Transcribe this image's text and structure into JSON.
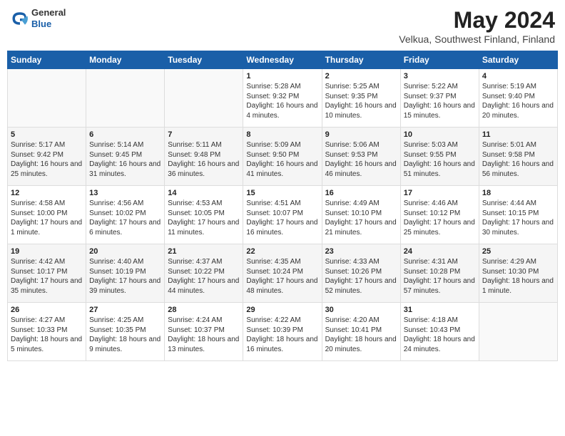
{
  "logo": {
    "general": "General",
    "blue": "Blue"
  },
  "title": "May 2024",
  "subtitle": "Velkua, Southwest Finland, Finland",
  "weekdays": [
    "Sunday",
    "Monday",
    "Tuesday",
    "Wednesday",
    "Thursday",
    "Friday",
    "Saturday"
  ],
  "weeks": [
    [
      {
        "day": "",
        "sunrise": "",
        "sunset": "",
        "daylight": ""
      },
      {
        "day": "",
        "sunrise": "",
        "sunset": "",
        "daylight": ""
      },
      {
        "day": "",
        "sunrise": "",
        "sunset": "",
        "daylight": ""
      },
      {
        "day": "1",
        "sunrise": "Sunrise: 5:28 AM",
        "sunset": "Sunset: 9:32 PM",
        "daylight": "Daylight: 16 hours and 4 minutes."
      },
      {
        "day": "2",
        "sunrise": "Sunrise: 5:25 AM",
        "sunset": "Sunset: 9:35 PM",
        "daylight": "Daylight: 16 hours and 10 minutes."
      },
      {
        "day": "3",
        "sunrise": "Sunrise: 5:22 AM",
        "sunset": "Sunset: 9:37 PM",
        "daylight": "Daylight: 16 hours and 15 minutes."
      },
      {
        "day": "4",
        "sunrise": "Sunrise: 5:19 AM",
        "sunset": "Sunset: 9:40 PM",
        "daylight": "Daylight: 16 hours and 20 minutes."
      }
    ],
    [
      {
        "day": "5",
        "sunrise": "Sunrise: 5:17 AM",
        "sunset": "Sunset: 9:42 PM",
        "daylight": "Daylight: 16 hours and 25 minutes."
      },
      {
        "day": "6",
        "sunrise": "Sunrise: 5:14 AM",
        "sunset": "Sunset: 9:45 PM",
        "daylight": "Daylight: 16 hours and 31 minutes."
      },
      {
        "day": "7",
        "sunrise": "Sunrise: 5:11 AM",
        "sunset": "Sunset: 9:48 PM",
        "daylight": "Daylight: 16 hours and 36 minutes."
      },
      {
        "day": "8",
        "sunrise": "Sunrise: 5:09 AM",
        "sunset": "Sunset: 9:50 PM",
        "daylight": "Daylight: 16 hours and 41 minutes."
      },
      {
        "day": "9",
        "sunrise": "Sunrise: 5:06 AM",
        "sunset": "Sunset: 9:53 PM",
        "daylight": "Daylight: 16 hours and 46 minutes."
      },
      {
        "day": "10",
        "sunrise": "Sunrise: 5:03 AM",
        "sunset": "Sunset: 9:55 PM",
        "daylight": "Daylight: 16 hours and 51 minutes."
      },
      {
        "day": "11",
        "sunrise": "Sunrise: 5:01 AM",
        "sunset": "Sunset: 9:58 PM",
        "daylight": "Daylight: 16 hours and 56 minutes."
      }
    ],
    [
      {
        "day": "12",
        "sunrise": "Sunrise: 4:58 AM",
        "sunset": "Sunset: 10:00 PM",
        "daylight": "Daylight: 17 hours and 1 minute."
      },
      {
        "day": "13",
        "sunrise": "Sunrise: 4:56 AM",
        "sunset": "Sunset: 10:02 PM",
        "daylight": "Daylight: 17 hours and 6 minutes."
      },
      {
        "day": "14",
        "sunrise": "Sunrise: 4:53 AM",
        "sunset": "Sunset: 10:05 PM",
        "daylight": "Daylight: 17 hours and 11 minutes."
      },
      {
        "day": "15",
        "sunrise": "Sunrise: 4:51 AM",
        "sunset": "Sunset: 10:07 PM",
        "daylight": "Daylight: 17 hours and 16 minutes."
      },
      {
        "day": "16",
        "sunrise": "Sunrise: 4:49 AM",
        "sunset": "Sunset: 10:10 PM",
        "daylight": "Daylight: 17 hours and 21 minutes."
      },
      {
        "day": "17",
        "sunrise": "Sunrise: 4:46 AM",
        "sunset": "Sunset: 10:12 PM",
        "daylight": "Daylight: 17 hours and 25 minutes."
      },
      {
        "day": "18",
        "sunrise": "Sunrise: 4:44 AM",
        "sunset": "Sunset: 10:15 PM",
        "daylight": "Daylight: 17 hours and 30 minutes."
      }
    ],
    [
      {
        "day": "19",
        "sunrise": "Sunrise: 4:42 AM",
        "sunset": "Sunset: 10:17 PM",
        "daylight": "Daylight: 17 hours and 35 minutes."
      },
      {
        "day": "20",
        "sunrise": "Sunrise: 4:40 AM",
        "sunset": "Sunset: 10:19 PM",
        "daylight": "Daylight: 17 hours and 39 minutes."
      },
      {
        "day": "21",
        "sunrise": "Sunrise: 4:37 AM",
        "sunset": "Sunset: 10:22 PM",
        "daylight": "Daylight: 17 hours and 44 minutes."
      },
      {
        "day": "22",
        "sunrise": "Sunrise: 4:35 AM",
        "sunset": "Sunset: 10:24 PM",
        "daylight": "Daylight: 17 hours and 48 minutes."
      },
      {
        "day": "23",
        "sunrise": "Sunrise: 4:33 AM",
        "sunset": "Sunset: 10:26 PM",
        "daylight": "Daylight: 17 hours and 52 minutes."
      },
      {
        "day": "24",
        "sunrise": "Sunrise: 4:31 AM",
        "sunset": "Sunset: 10:28 PM",
        "daylight": "Daylight: 17 hours and 57 minutes."
      },
      {
        "day": "25",
        "sunrise": "Sunrise: 4:29 AM",
        "sunset": "Sunset: 10:30 PM",
        "daylight": "Daylight: 18 hours and 1 minute."
      }
    ],
    [
      {
        "day": "26",
        "sunrise": "Sunrise: 4:27 AM",
        "sunset": "Sunset: 10:33 PM",
        "daylight": "Daylight: 18 hours and 5 minutes."
      },
      {
        "day": "27",
        "sunrise": "Sunrise: 4:25 AM",
        "sunset": "Sunset: 10:35 PM",
        "daylight": "Daylight: 18 hours and 9 minutes."
      },
      {
        "day": "28",
        "sunrise": "Sunrise: 4:24 AM",
        "sunset": "Sunset: 10:37 PM",
        "daylight": "Daylight: 18 hours and 13 minutes."
      },
      {
        "day": "29",
        "sunrise": "Sunrise: 4:22 AM",
        "sunset": "Sunset: 10:39 PM",
        "daylight": "Daylight: 18 hours and 16 minutes."
      },
      {
        "day": "30",
        "sunrise": "Sunrise: 4:20 AM",
        "sunset": "Sunset: 10:41 PM",
        "daylight": "Daylight: 18 hours and 20 minutes."
      },
      {
        "day": "31",
        "sunrise": "Sunrise: 4:18 AM",
        "sunset": "Sunset: 10:43 PM",
        "daylight": "Daylight: 18 hours and 24 minutes."
      },
      {
        "day": "",
        "sunrise": "",
        "sunset": "",
        "daylight": ""
      }
    ]
  ]
}
